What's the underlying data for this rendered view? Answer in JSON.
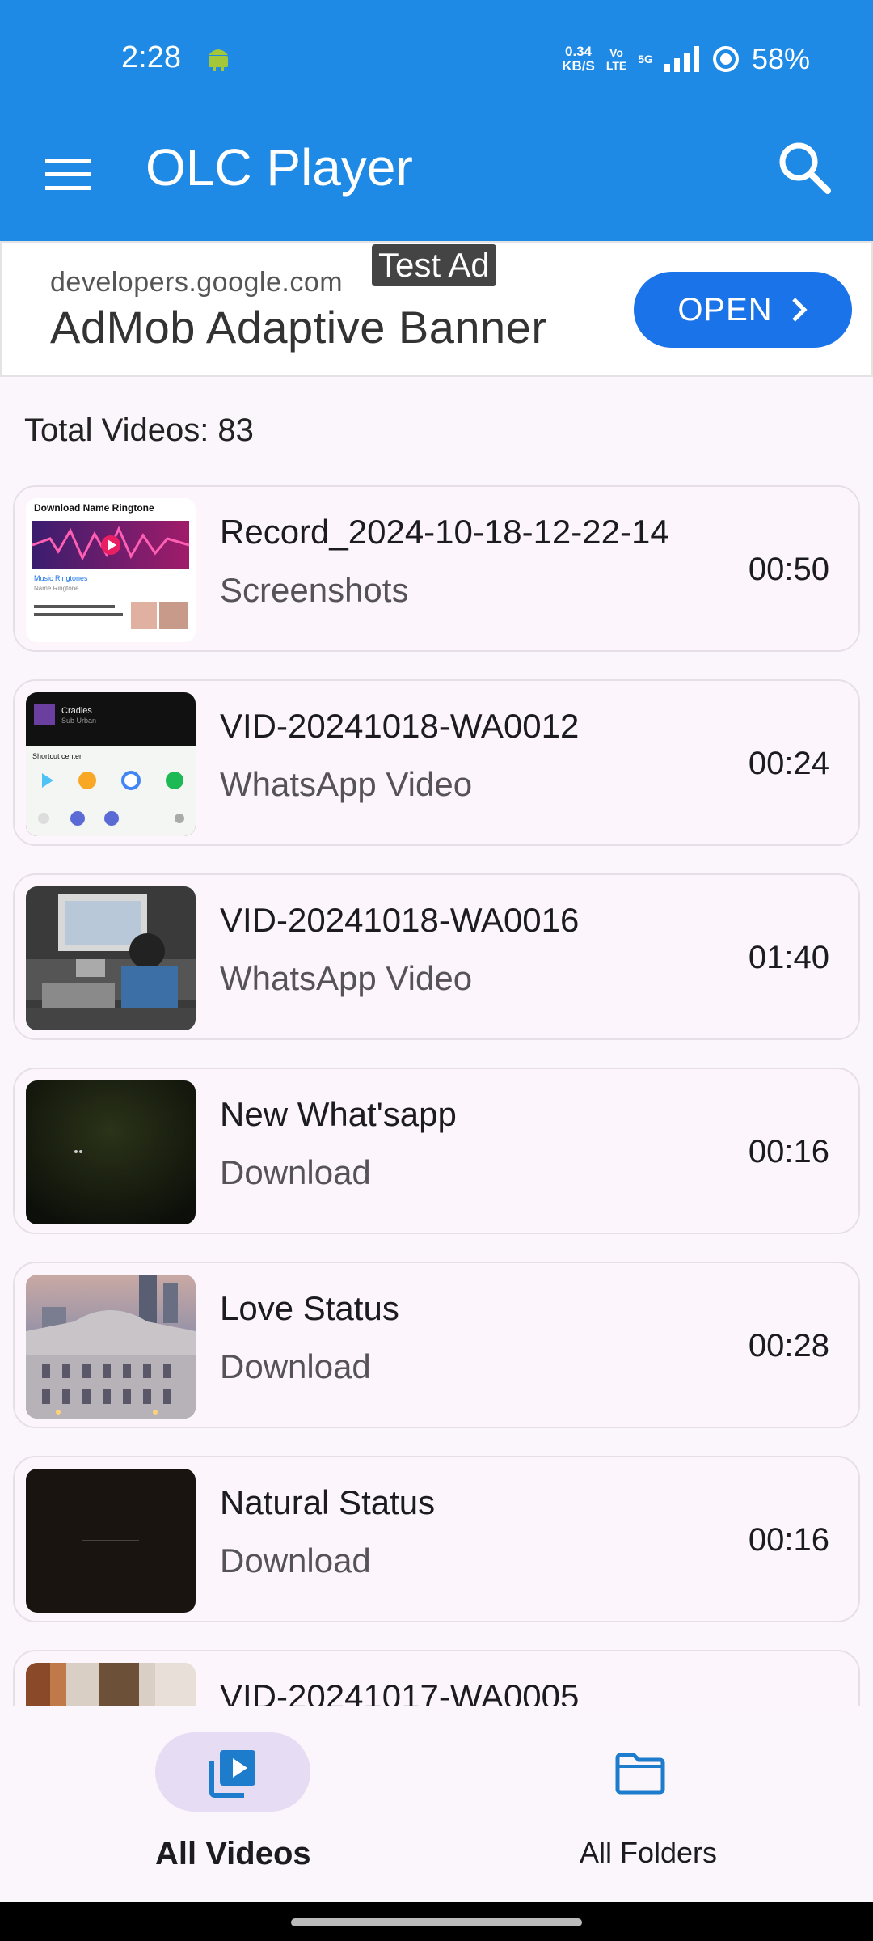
{
  "status_bar": {
    "time": "2:28",
    "net_speed_value": "0.34",
    "net_speed_unit": "KB/S",
    "volte_top": "Vo",
    "volte_bottom": "LTE",
    "network": "5G",
    "battery": "58%"
  },
  "app_bar": {
    "title": "OLC Player"
  },
  "ad": {
    "domain": "developers.google.com",
    "test_label": "Test Ad",
    "title": "AdMob Adaptive Banner",
    "open_label": "OPEN"
  },
  "summary": {
    "total_videos": "Total Videos: 83"
  },
  "videos": [
    {
      "title": "Record_2024-10-18-12-22-14",
      "folder": "Screenshots",
      "duration": "00:50"
    },
    {
      "title": "VID-20241018-WA0012",
      "folder": "WhatsApp Video",
      "duration": "00:24"
    },
    {
      "title": "VID-20241018-WA0016",
      "folder": "WhatsApp Video",
      "duration": "01:40"
    },
    {
      "title": "New What'sapp",
      "folder": "Download",
      "duration": "00:16"
    },
    {
      "title": "Love Status",
      "folder": "Download",
      "duration": "00:28"
    },
    {
      "title": "Natural Status",
      "folder": "Download",
      "duration": "00:16"
    },
    {
      "title": "VID-20241017-WA0005",
      "folder": "",
      "duration": ""
    }
  ],
  "thumb_text": {
    "t1_header": "Download Name Ringtone",
    "t1_line1": "Music Ringtones",
    "t1_line2": "Name Ringtone",
    "t2_song": "Cradles",
    "t2_artist": "Sub Urban",
    "t2_panel": "Shortcut center"
  },
  "bottom_nav": {
    "all_videos": "All Videos",
    "all_folders": "All Folders"
  },
  "colors": {
    "primary": "#1e8ae6",
    "ad_button": "#1a73e8",
    "nav_active_pill": "#e6dcf3",
    "nav_icon": "#1d7ccc"
  }
}
